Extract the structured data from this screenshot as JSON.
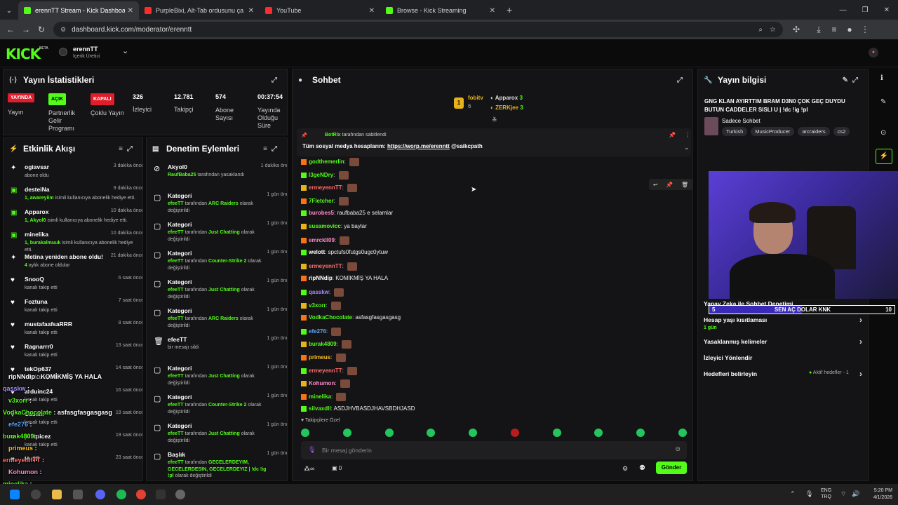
{
  "browser": {
    "tabs": [
      {
        "title": "erennTT Stream - Kick Dashboa",
        "color": "#53fc18"
      },
      {
        "title": "PurpleBixi, Alt-Tab ordusunu ça",
        "color": "#ff2b2b"
      },
      {
        "title": "YouTube",
        "color": "#ff2b2b"
      },
      {
        "title": "Browse - Kick Streaming",
        "color": "#53fc18"
      }
    ],
    "url": "dashboard.kick.com/moderator/erenntt"
  },
  "header": {
    "logo": "KICK",
    "logo_tag": "BETA",
    "user_name": "erennTT",
    "user_role": "İçerik Üretici"
  },
  "stats": {
    "title": "Yayın İstatistikleri",
    "live_badge": "YAYINDA",
    "live_label": "Yayın",
    "partner_badge": "AÇIK",
    "partner_label": "Partnerlik Gelir Programı",
    "multi_badge": "KAPALI",
    "multi_label": "Çoklu Yayın",
    "viewers": "326",
    "viewers_label": "İzleyici",
    "followers": "12.781",
    "followers_label": "Takipçi",
    "subs": "574",
    "subs_label": "Abone Sayısı",
    "uptime": "00:37:54",
    "uptime_label": "Yayında Olduğu Süre"
  },
  "activity": {
    "title": "Etkinlik Akışı",
    "items": [
      {
        "icon": "✦",
        "name": "ogiavsar",
        "time": "3 dakika önce",
        "sub": "abone oldu"
      },
      {
        "icon": "▣",
        "name": "desteiNa",
        "time": "9 dakika önce",
        "hl": "1, awareyiim",
        "sub": "isimli kullanıcıya abonelik hediye etti."
      },
      {
        "icon": "▣",
        "name": "Apparox",
        "time": "10 dakika önce",
        "hl": "1, Akyol0",
        "sub": "isimli kullanıcıya abonelik hediye etti."
      },
      {
        "icon": "▣",
        "name": "minelika",
        "time": "10 dakika önce",
        "hl": "1, burakalmuuk",
        "sub": "isimli kullanıcıya abonelik hediye etti."
      },
      {
        "icon": "✦",
        "name": "Metina yeniden abone oldu!",
        "time": "21 dakika önce",
        "hl": "4",
        "sub": "aylık abone oldular"
      },
      {
        "icon": "♥",
        "name": "SnooQ",
        "time": "6 saat önce",
        "sub": "kanalı takip etti"
      },
      {
        "icon": "♥",
        "name": "Foztuna",
        "time": "7 saat önce",
        "sub": "kanalı takip etti"
      },
      {
        "icon": "♥",
        "name": "mustafaafsaRRR",
        "time": "8 saat önce",
        "sub": "kanalı takip etti"
      },
      {
        "icon": "♥",
        "name": "Ragnarrr0",
        "time": "13 saat önce",
        "sub": "kanalı takip etti"
      },
      {
        "icon": "♥",
        "name": "tekOp637",
        "time": "14 saat önce",
        "sub": "kanalı takip etti"
      },
      {
        "icon": "♥",
        "name": "arduinc24",
        "time": "16 saat önce",
        "sub": "kanalı takip etti"
      },
      {
        "icon": "♥",
        "name": "Casilix",
        "time": "19 saat önce",
        "sub": "kanalı takip etti"
      },
      {
        "icon": "♥",
        "name": "pratpicez",
        "time": "19 saat önce",
        "sub": "kanalı takip etti"
      },
      {
        "icon": "♥",
        "name": "Hu3P",
        "time": "23 saat önce",
        "sub": ""
      }
    ]
  },
  "moderation": {
    "title": "Denetim Eylemleri",
    "items": [
      {
        "icon": "⊘",
        "name": "Akyol0",
        "time": "1 dakika önce",
        "hl": "RaufBaba25",
        "sub": "tarafından yasaklandı"
      },
      {
        "icon": "▢",
        "name": "Kategori",
        "time": "1 gün önce",
        "hl": "efeeTT",
        "sub": "tarafından",
        "hl2": "ARC Raiders",
        "sub2": "olarak değiştirildi"
      },
      {
        "icon": "▢",
        "name": "Kategori",
        "time": "1 gün önce",
        "hl": "efeeTT",
        "sub": "tarafından",
        "hl2": "Just Chatting",
        "sub2": "olarak değiştirildi"
      },
      {
        "icon": "▢",
        "name": "Kategori",
        "time": "1 gün önce",
        "hl": "efeeTT",
        "sub": "tarafından",
        "hl2": "Counter-Strike 2",
        "sub2": "olarak değiştirildi"
      },
      {
        "icon": "▢",
        "name": "Kategori",
        "time": "1 gün önce",
        "hl": "efeeTT",
        "sub": "tarafından",
        "hl2": "Just Chatting",
        "sub2": "olarak değiştirildi"
      },
      {
        "icon": "▢",
        "name": "Kategori",
        "time": "1 gün önce",
        "hl": "efeeTT",
        "sub": "tarafından",
        "hl2": "ARC Raiders",
        "sub2": "olarak değiştirildi"
      },
      {
        "icon": "🗑",
        "name": "efeeTT",
        "time": "1 gün önce",
        "hl": "",
        "sub": "bir mesajı sildi"
      },
      {
        "icon": "▢",
        "name": "Kategori",
        "time": "1 gün önce",
        "hl": "efeeTT",
        "sub": "tarafından",
        "hl2": "Just Chatting",
        "sub2": "olarak değiştirildi"
      },
      {
        "icon": "▢",
        "name": "Kategori",
        "time": "1 gün önce",
        "hl": "efeeTT",
        "sub": "tarafından",
        "hl2": "Counter-Strike 2",
        "sub2": "olarak değiştirildi"
      },
      {
        "icon": "▢",
        "name": "Kategori",
        "time": "1 gün önce",
        "hl": "efeeTT",
        "sub": "tarafından",
        "hl2": "Just Chatting",
        "sub2": "olarak değiştirildi"
      },
      {
        "icon": "▢",
        "name": "Başlık",
        "time": "1 gün önce",
        "hl": "efeeTT",
        "sub": "tarafından",
        "hl2": "GECELERDEYIM, GECELERDESIN, GECELERDEYIZ | !dc !ig !pl",
        "sub2": "olarak değiştirildi"
      }
    ]
  },
  "chat": {
    "title": "Sohbet",
    "top_gifters": [
      {
        "name": "fobitv",
        "count": "6"
      },
      {
        "name": "Apparox",
        "count": "3"
      },
      {
        "name": "ZERKjee",
        "count": "3"
      }
    ],
    "pinned_by": "BotRix",
    "pinned_by_suffix": "tarafından sabitlendi",
    "pinned_msg": "Tüm sosyal medya hesaplarım:",
    "pinned_link": "https://worp.me/erenntt",
    "pinned_handle": "@saikcpath",
    "messages": [
      {
        "user": "godthemerlin",
        "color": "#53fc18",
        "text": "",
        "emote": true
      },
      {
        "user": "l3geNDry",
        "color": "#53fc18",
        "text": "",
        "emote": true
      },
      {
        "user": "ermeyennTT",
        "color": "#ff6b6b",
        "text": "",
        "emote": true
      },
      {
        "user": "7Fletcher",
        "color": "#53fc18",
        "text": "",
        "emote": true
      },
      {
        "user": "burobes5",
        "color": "#ff8cc6",
        "text": "raufbaba25 e selamlar"
      },
      {
        "user": "susamovicc",
        "color": "#53fc18",
        "text": "ya baylar"
      },
      {
        "user": "emrckll09",
        "color": "#ff8cc6",
        "text": "",
        "emote": true
      },
      {
        "user": "welott",
        "color": "#fff",
        "text": "spctufs0futgs0ugc0ytuw"
      },
      {
        "user": "ermeyennTT",
        "color": "#ff6b6b",
        "text": "",
        "emote": true
      },
      {
        "user": "ripNNdip",
        "color": "#fff",
        "text": "KOMİKMİŞ YA HALA"
      },
      {
        "user": "qasskw",
        "color": "#a78bfa",
        "text": "",
        "emote": true
      },
      {
        "user": "v3xorr",
        "color": "#53fc18",
        "text": "",
        "emote": true
      },
      {
        "user": "VodkaChocolate",
        "color": "#53fc18",
        "text": "asfasgfasgasgasg"
      },
      {
        "user": "efe276",
        "color": "#60a5fa",
        "text": "",
        "emote": true
      },
      {
        "user": "burak4809",
        "color": "#53fc18",
        "text": "",
        "emote": true
      },
      {
        "user": "primeus",
        "color": "#fbbf24",
        "text": "",
        "emote": true
      },
      {
        "user": "ermeyennTT",
        "color": "#ff6b6b",
        "text": "",
        "emote": true
      },
      {
        "user": "Kohumon",
        "color": "#ff8cc6",
        "text": "",
        "emote": true
      },
      {
        "user": "minelika",
        "color": "#53fc18",
        "text": "",
        "emote": true
      },
      {
        "user": "silvaxdll",
        "color": "#53fc18",
        "text": "ASDJHVBASDJHAVSBDHJASD"
      }
    ],
    "followers_only": "Takipçilere Özel",
    "input_placeholder": "Bir mesaj gönderin",
    "points": "0",
    "send_label": "Gönder"
  },
  "stream_info": {
    "title": "Yayın bilgisi",
    "stream_title": "GNG KLAN AYIRTTIM BRAM D3N0 ÇOK GEÇ DUYDU BUTUN CADDELER SISLI U | !dc !ig !pl",
    "category": "Sadece Sohbet",
    "tags": [
      "Turkish",
      "MusicProducer",
      "arcraiders",
      "cs2"
    ]
  },
  "settings": {
    "ai_mod": "Yapay Zeka ile Sohbet Denetimi",
    "account_age": "Hesap yaşı kısıtlaması",
    "account_age_val": "1 gün",
    "banned_words": "Yasaklanmış kelimeler",
    "redirect": "İzleyici Yönlendir",
    "goals": "Hedefleri belirleyin",
    "goals_val": "Aktif hedefler - 1"
  },
  "goal_bar": {
    "left": "5",
    "label": "SEN AÇ DOLAR KNK",
    "right": "10",
    "progress": 0.5
  },
  "overlay_chat": [
    {
      "user": "ripNNdip",
      "text": "KOMİKMİŞ YA HALA",
      "color": "#ffffff"
    },
    {
      "user": "qasskw",
      "text": "",
      "color": "#a78bfa"
    },
    {
      "user": "v3xorr",
      "text": "",
      "color": "#53fc18"
    },
    {
      "user": "VodkaChocolate",
      "text": "asfasgfasgasgasg",
      "color": "#53fc18"
    },
    {
      "user": "efe276",
      "text": "",
      "color": "#60a5fa"
    },
    {
      "user": "burak4809",
      "text": "",
      "color": "#53fc18"
    },
    {
      "user": "primeus",
      "text": "",
      "color": "#fbbf24"
    },
    {
      "user": "ermeyennTT",
      "text": "",
      "color": "#ff6b6b"
    },
    {
      "user": "Kohumon",
      "text": "",
      "color": "#ff8cc6"
    },
    {
      "user": "minelika",
      "text": "",
      "color": "#53fc18"
    },
    {
      "user": "silvaxdll",
      "text": "ASDJHVBASDJHAVSBDHJASD",
      "color": "#53fc18"
    }
  ],
  "taskbar": {
    "lang1": "ENG",
    "lang2": "TRQ",
    "time": "5:20 PM",
    "date": "4/1/2026"
  }
}
